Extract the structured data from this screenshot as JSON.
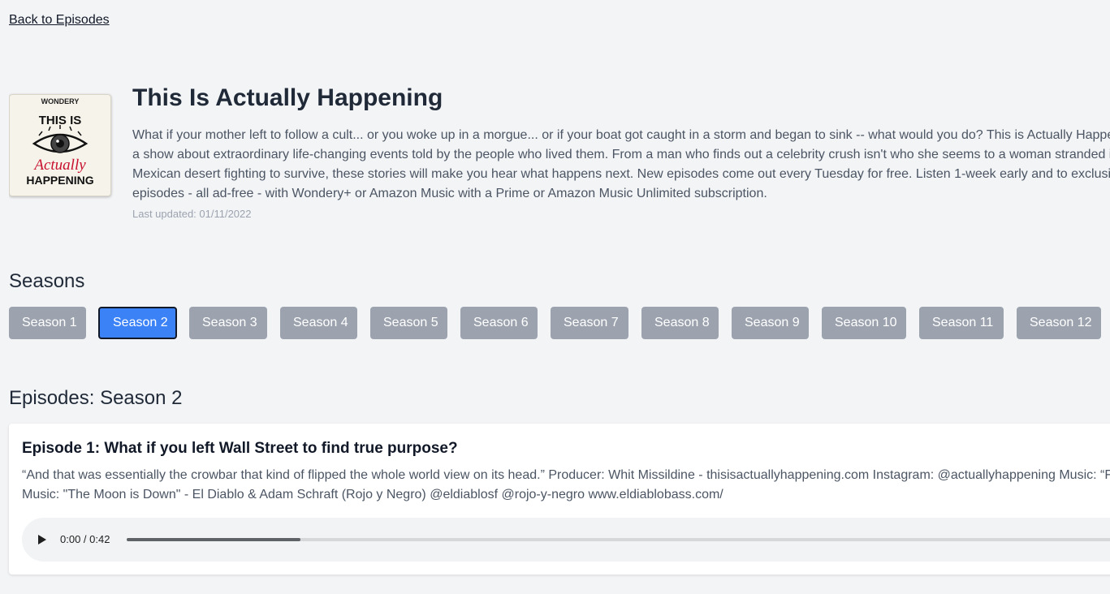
{
  "nav": {
    "back_label": "Back to Episodes"
  },
  "podcast": {
    "cover": {
      "publisher": "WONDERY",
      "line1": "THIS IS",
      "line2": "Actually",
      "line3": "HAPPENING"
    },
    "title": "This Is Actually Happening",
    "description": "What if your mother left to follow a cult... or you woke up in a morgue... or if your boat got caught in a storm and began to sink -- what would you do?   This is Actually Happening is a show about extraordinary life-changing events told by the people who lived them. From a man who finds out a celebrity crush isn't who she seems to a woman stranded in a Mexican desert fighting to survive, these stories will make you hear what happens next. New episodes come out every Tuesday for free. Listen 1-week early and to exclusive past episodes - all ad-free - with Wondery+ or Amazon Music with a Prime or Amazon Music Unlimited subscription.",
    "last_updated": "Last updated: 01/11/2022"
  },
  "seasons": {
    "heading": "Seasons",
    "selected_index": 1,
    "items": [
      {
        "label": "Season 1"
      },
      {
        "label": "Season 2"
      },
      {
        "label": "Season 3"
      },
      {
        "label": "Season 4"
      },
      {
        "label": "Season 5"
      },
      {
        "label": "Season 6"
      },
      {
        "label": "Season 7"
      },
      {
        "label": "Season 8"
      },
      {
        "label": "Season 9"
      },
      {
        "label": "Season 10"
      },
      {
        "label": "Season 11"
      },
      {
        "label": "Season 12"
      }
    ]
  },
  "episodes": {
    "heading": "Episodes: Season 2",
    "items": [
      {
        "title": "Episode 1: What if you left Wall Street to find true purpose?",
        "description": "“And that was essentially the crowbar that kind of flipped the whole world view on its head.” Producer: Whit Missildine - thisisactuallyhappening.com Instagram: @actuallyhappening Music: “F... Music: \"The Moon is Down\" - El Diablo & Adam Schraft (Rojo y Negro) @eldiablosf @rojo-y-negro www.eldiablobass.com/",
        "player": {
          "time": "0:00 / 0:42",
          "progress_fraction": 0.17
        }
      }
    ]
  },
  "colors": {
    "background": "#f3f4f6",
    "season_button": "#9ca3af",
    "season_button_active": "#3b82f6",
    "cover_accent": "#c8102e"
  }
}
